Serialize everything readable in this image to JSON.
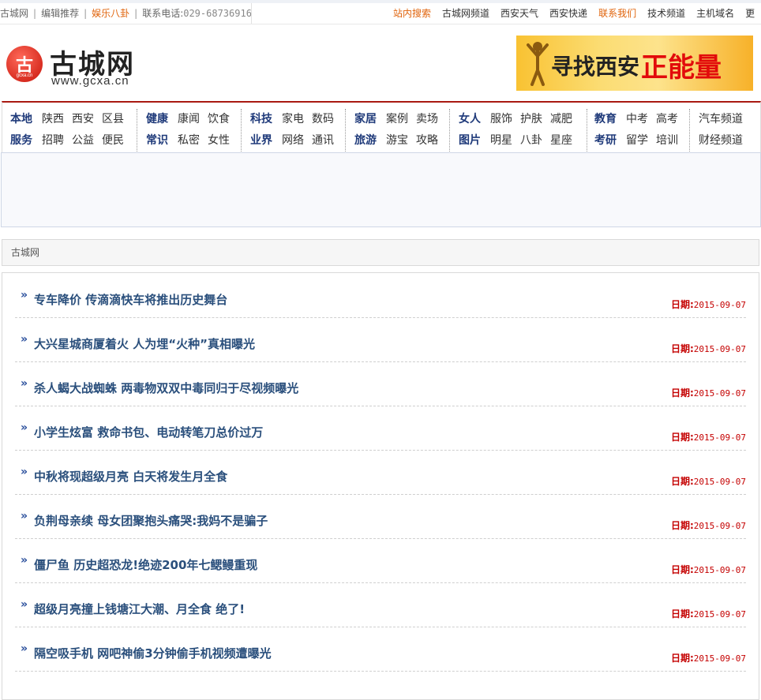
{
  "topbar": {
    "left": [
      {
        "text": "古城网",
        "style": "gray"
      },
      {
        "text": "编辑推荐",
        "style": "gray"
      },
      {
        "text": "娱乐八卦",
        "style": "orange"
      },
      {
        "text": "联系电话:",
        "style": "phone-label"
      }
    ],
    "phone": "029-68736916",
    "right": [
      {
        "text": "站内搜索",
        "hl": true
      },
      {
        "text": "古城网频道",
        "hl": false
      },
      {
        "text": "西安天气",
        "hl": false
      },
      {
        "text": "西安快递",
        "hl": false
      },
      {
        "text": "联系我们",
        "hl": true
      },
      {
        "text": "技术频道",
        "hl": false
      },
      {
        "text": "主机域名",
        "hl": false
      },
      {
        "text": "更",
        "hl": false
      }
    ]
  },
  "logo": {
    "glyph": "古",
    "mini": "gcxa.cn",
    "title": "古城网",
    "url": "www.gcxa.cn"
  },
  "banner": {
    "text1": "寻找西安",
    "text2": "正能量"
  },
  "nav": [
    {
      "row1": [
        "本地",
        "陕西",
        "西安",
        "区县"
      ],
      "row2": [
        "服务",
        "招聘",
        "公益",
        "便民"
      ]
    },
    {
      "row1": [
        "健康",
        "康闻",
        "饮食"
      ],
      "row2": [
        "常识",
        "私密",
        "女性"
      ]
    },
    {
      "row1": [
        "科技",
        "家电",
        "数码"
      ],
      "row2": [
        "业界",
        "网络",
        "通讯"
      ]
    },
    {
      "row1": [
        "家居",
        "案例",
        "卖场"
      ],
      "row2": [
        "旅游",
        "游宝",
        "攻略"
      ]
    },
    {
      "row1": [
        "女人",
        "服饰",
        "护肤",
        "减肥"
      ],
      "row2": [
        "图片",
        "明星",
        "八卦",
        "星座"
      ]
    },
    {
      "row1": [
        "教育",
        "中考",
        "高考"
      ],
      "row2": [
        "考研",
        "留学",
        "培训"
      ]
    },
    {
      "row1": [
        "汽车频道"
      ],
      "row2": [
        "财经频道"
      ]
    }
  ],
  "breadcrumb": "古城网",
  "date_label": "日期:",
  "articles": [
    {
      "title": "专车降价 传滴滴快车将推出历史舞台",
      "date": "2015-09-07"
    },
    {
      "title": "大兴星城商厦着火 人为埋“火种”真相曝光",
      "date": "2015-09-07"
    },
    {
      "title": "杀人蝎大战蜘蛛 两毒物双双中毒同归于尽视频曝光",
      "date": "2015-09-07"
    },
    {
      "title": "小学生炫富 救命书包、电动转笔刀总价过万",
      "date": "2015-09-07"
    },
    {
      "title": "中秋将现超级月亮 白天将发生月全食",
      "date": "2015-09-07"
    },
    {
      "title": "负荆母亲续 母女团聚抱头痛哭:我妈不是骗子",
      "date": "2015-09-07"
    },
    {
      "title": "僵尸鱼 历史超恐龙!绝迹200年七鳃鳗重现",
      "date": "2015-09-07"
    },
    {
      "title": "超级月亮撞上钱塘江大潮、月全食 绝了!",
      "date": "2015-09-07"
    },
    {
      "title": "隔空吸手机 网吧神偷3分钟偷手机视频遭曝光",
      "date": "2015-09-07"
    }
  ]
}
